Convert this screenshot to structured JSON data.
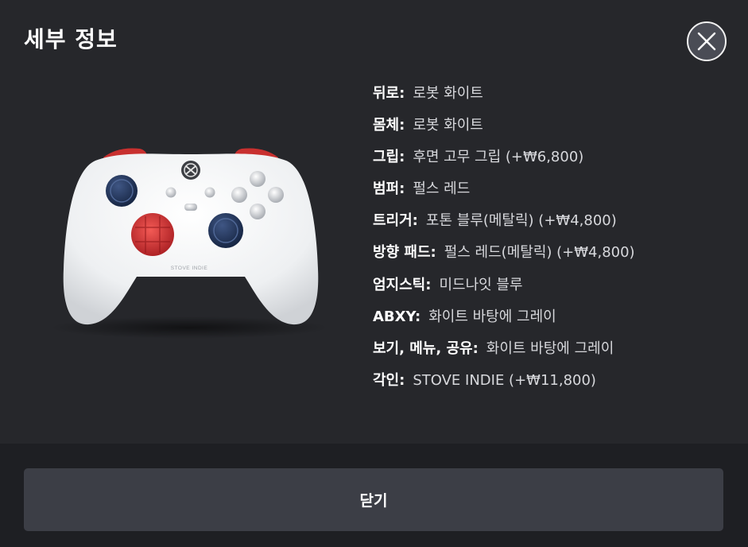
{
  "dialog": {
    "title": "세부 정보",
    "close_icon": "close-icon",
    "footer_button_label": "닫기"
  },
  "product_image": {
    "engraving_text": "STOVE INDIE"
  },
  "details": [
    {
      "label": "뒤로:",
      "value": "로봇 화이트"
    },
    {
      "label": "몸체:",
      "value": "로봇 화이트"
    },
    {
      "label": "그립:",
      "value": "후면 고무 그립 (+₩6,800)"
    },
    {
      "label": "범퍼:",
      "value": "펄스 레드"
    },
    {
      "label": "트리거:",
      "value": "포톤 블루(메탈릭) (+₩4,800)"
    },
    {
      "label": "방향 패드:",
      "value": "펄스 레드(메탈릭) (+₩4,800)"
    },
    {
      "label": "엄지스틱:",
      "value": "미드나잇 블루"
    },
    {
      "label": "ABXY:",
      "value": "화이트 바탕에 그레이"
    },
    {
      "label": "보기, 메뉴, 공유:",
      "value": "화이트 바탕에 그레이"
    },
    {
      "label": "각인:",
      "value": "STOVE INDIE (+₩11,800)"
    }
  ],
  "colors": {
    "background": "#26272b",
    "footer_background": "#1e1f23",
    "button_background": "#3c3e46",
    "controller_body": "#f1f2f4",
    "bumper": "#c8302f",
    "dpad": "#d8393a",
    "thumbstick": "#23375e"
  }
}
